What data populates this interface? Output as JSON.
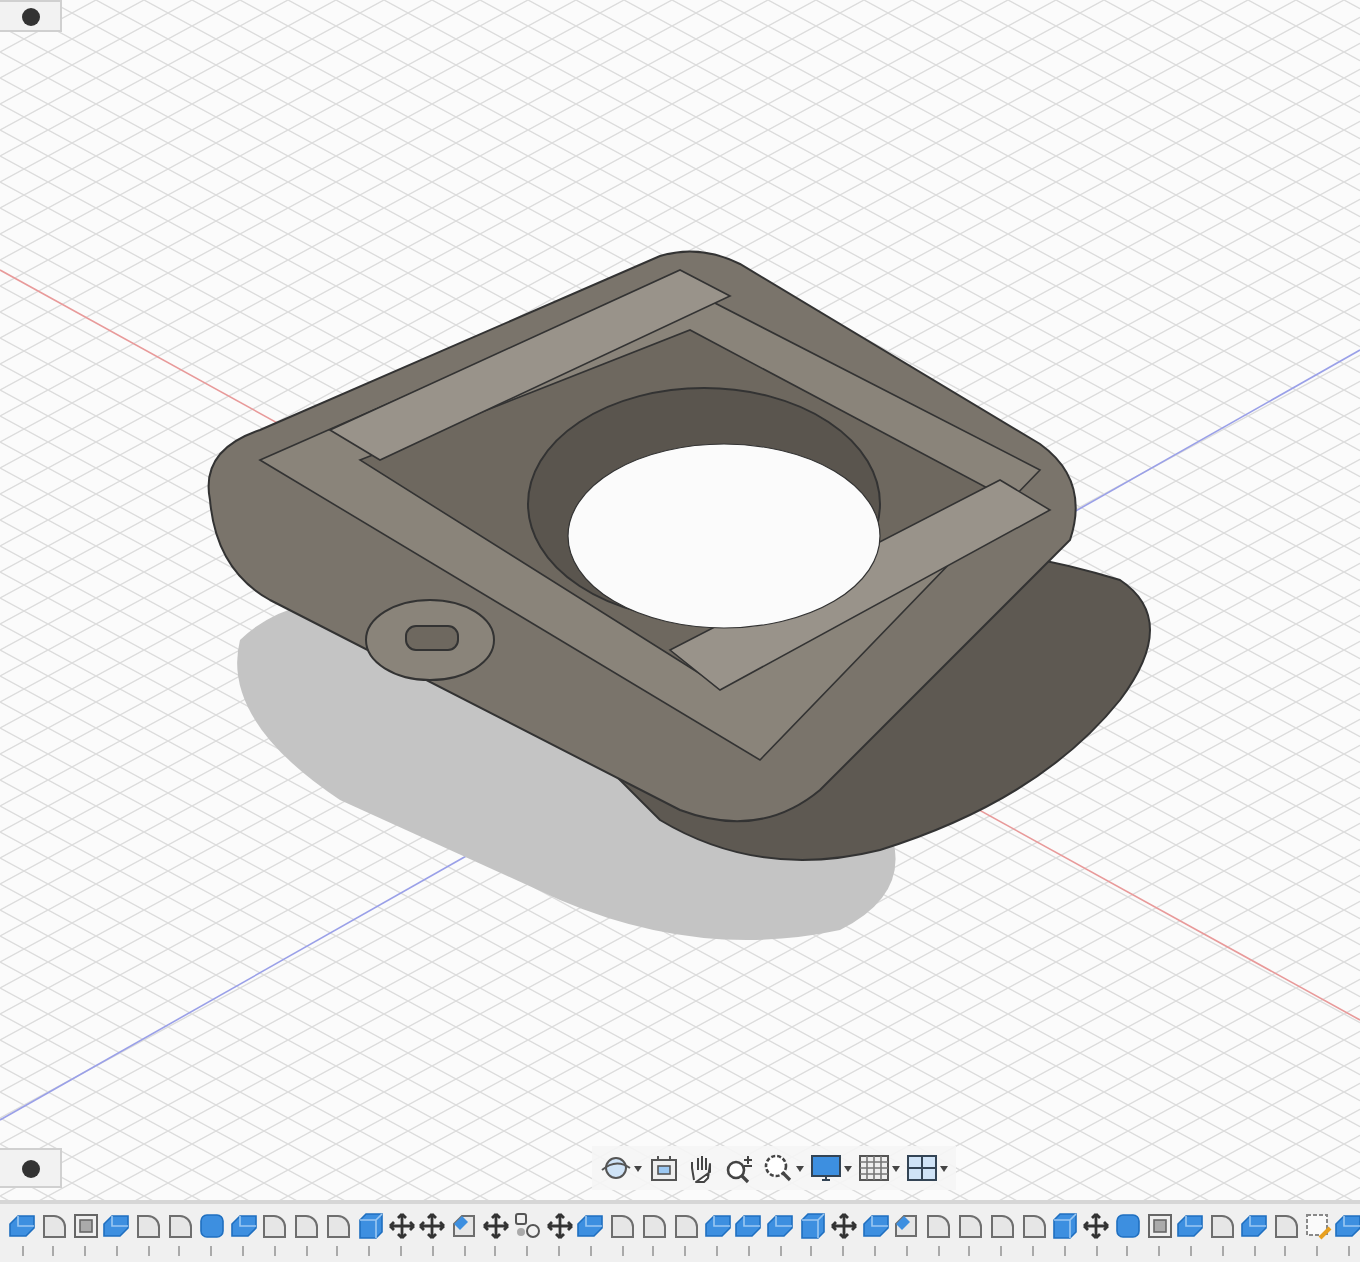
{
  "navigation_toolbar": {
    "tools": [
      {
        "kind": "orbit",
        "menu": true
      },
      {
        "kind": "look-at",
        "menu": false
      },
      {
        "kind": "pan",
        "menu": false
      },
      {
        "kind": "zoom",
        "menu": false
      },
      {
        "kind": "fit",
        "menu": true
      },
      {
        "kind": "display",
        "menu": true
      },
      {
        "kind": "grid",
        "menu": true
      },
      {
        "kind": "viewports",
        "menu": true
      }
    ]
  },
  "timeline": {
    "items": [
      {
        "kind": "extrude"
      },
      {
        "kind": "fillet"
      },
      {
        "kind": "shell"
      },
      {
        "kind": "extrude"
      },
      {
        "kind": "fillet"
      },
      {
        "kind": "fillet"
      },
      {
        "kind": "cylinder"
      },
      {
        "kind": "extrude"
      },
      {
        "kind": "fillet"
      },
      {
        "kind": "fillet"
      },
      {
        "kind": "fillet"
      },
      {
        "kind": "box"
      },
      {
        "kind": "move"
      },
      {
        "kind": "move"
      },
      {
        "kind": "chamfer"
      },
      {
        "kind": "move"
      },
      {
        "kind": "pattern"
      },
      {
        "kind": "move"
      },
      {
        "kind": "extrude"
      },
      {
        "kind": "fillet"
      },
      {
        "kind": "fillet"
      },
      {
        "kind": "fillet"
      },
      {
        "kind": "extrude"
      },
      {
        "kind": "extrude"
      },
      {
        "kind": "extrude"
      },
      {
        "kind": "box"
      },
      {
        "kind": "move"
      },
      {
        "kind": "extrude"
      },
      {
        "kind": "chamfer"
      },
      {
        "kind": "fillet"
      },
      {
        "kind": "fillet"
      },
      {
        "kind": "fillet"
      },
      {
        "kind": "fillet"
      },
      {
        "kind": "box"
      },
      {
        "kind": "move"
      },
      {
        "kind": "cylinder"
      },
      {
        "kind": "shell"
      },
      {
        "kind": "extrude"
      },
      {
        "kind": "fillet"
      },
      {
        "kind": "extrude"
      },
      {
        "kind": "fillet"
      },
      {
        "kind": "sketch"
      },
      {
        "kind": "extrude"
      }
    ]
  }
}
